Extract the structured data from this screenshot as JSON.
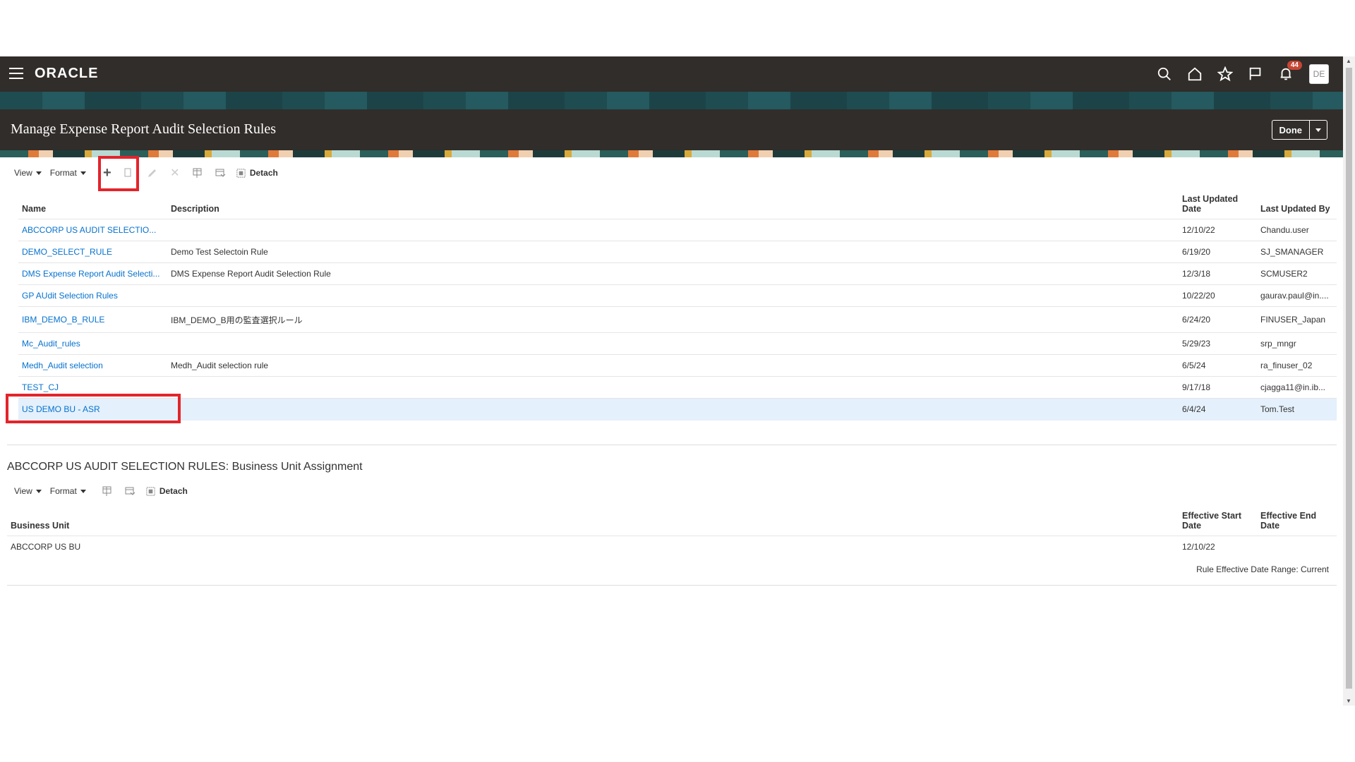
{
  "header": {
    "logo": "ORACLE",
    "notification_count": "44",
    "avatar_initials": "DE",
    "icons": [
      "menu-icon",
      "search-icon",
      "home-icon",
      "star-icon",
      "flag-icon",
      "bell-icon"
    ]
  },
  "page": {
    "title": "Manage Expense Report Audit Selection Rules",
    "done_label": "Done"
  },
  "toolbar1": {
    "view_label": "View",
    "format_label": "Format",
    "detach_label": "Detach"
  },
  "rules_table": {
    "columns": {
      "name": "Name",
      "description": "Description",
      "last_updated_date": "Last Updated Date",
      "last_updated_by": "Last Updated By"
    },
    "rows": [
      {
        "name": "ABCCORP US AUDIT SELECTIO...",
        "description": "",
        "date": "12/10/22",
        "by": "Chandu.user"
      },
      {
        "name": "DEMO_SELECT_RULE",
        "description": "Demo Test Selectoin Rule",
        "date": "6/19/20",
        "by": "SJ_SMANAGER"
      },
      {
        "name": "DMS Expense Report Audit Selecti...",
        "description": "DMS Expense Report Audit Selection Rule",
        "date": "12/3/18",
        "by": "SCMUSER2"
      },
      {
        "name": "GP AUdit Selection Rules",
        "description": "",
        "date": "10/22/20",
        "by": "gaurav.paul@in...."
      },
      {
        "name": "IBM_DEMO_B_RULE",
        "description": "IBM_DEMO_B用の監査選択ルール",
        "date": "6/24/20",
        "by": "FINUSER_Japan"
      },
      {
        "name": "Mc_Audit_rules",
        "description": "",
        "date": "5/29/23",
        "by": "srp_mngr"
      },
      {
        "name": "Medh_Audit selection",
        "description": "Medh_Audit selection rule",
        "date": "6/5/24",
        "by": "ra_finuser_02"
      },
      {
        "name": "TEST_CJ",
        "description": "",
        "date": "9/17/18",
        "by": "cjagga11@in.ib..."
      },
      {
        "name": "US DEMO BU - ASR",
        "description": "",
        "date": "6/4/24",
        "by": "Tom.Test"
      }
    ]
  },
  "assignment": {
    "title": "ABCCORP US AUDIT SELECTION RULES: Business Unit Assignment",
    "view_label": "View",
    "format_label": "Format",
    "detach_label": "Detach",
    "columns": {
      "business_unit": "Business Unit",
      "start": "Effective Start Date",
      "end": "Effective End Date"
    },
    "rows": [
      {
        "bu": "ABCCORP US BU",
        "start": "12/10/22",
        "end": ""
      }
    ],
    "range_text": "Rule Effective Date Range: Current"
  }
}
